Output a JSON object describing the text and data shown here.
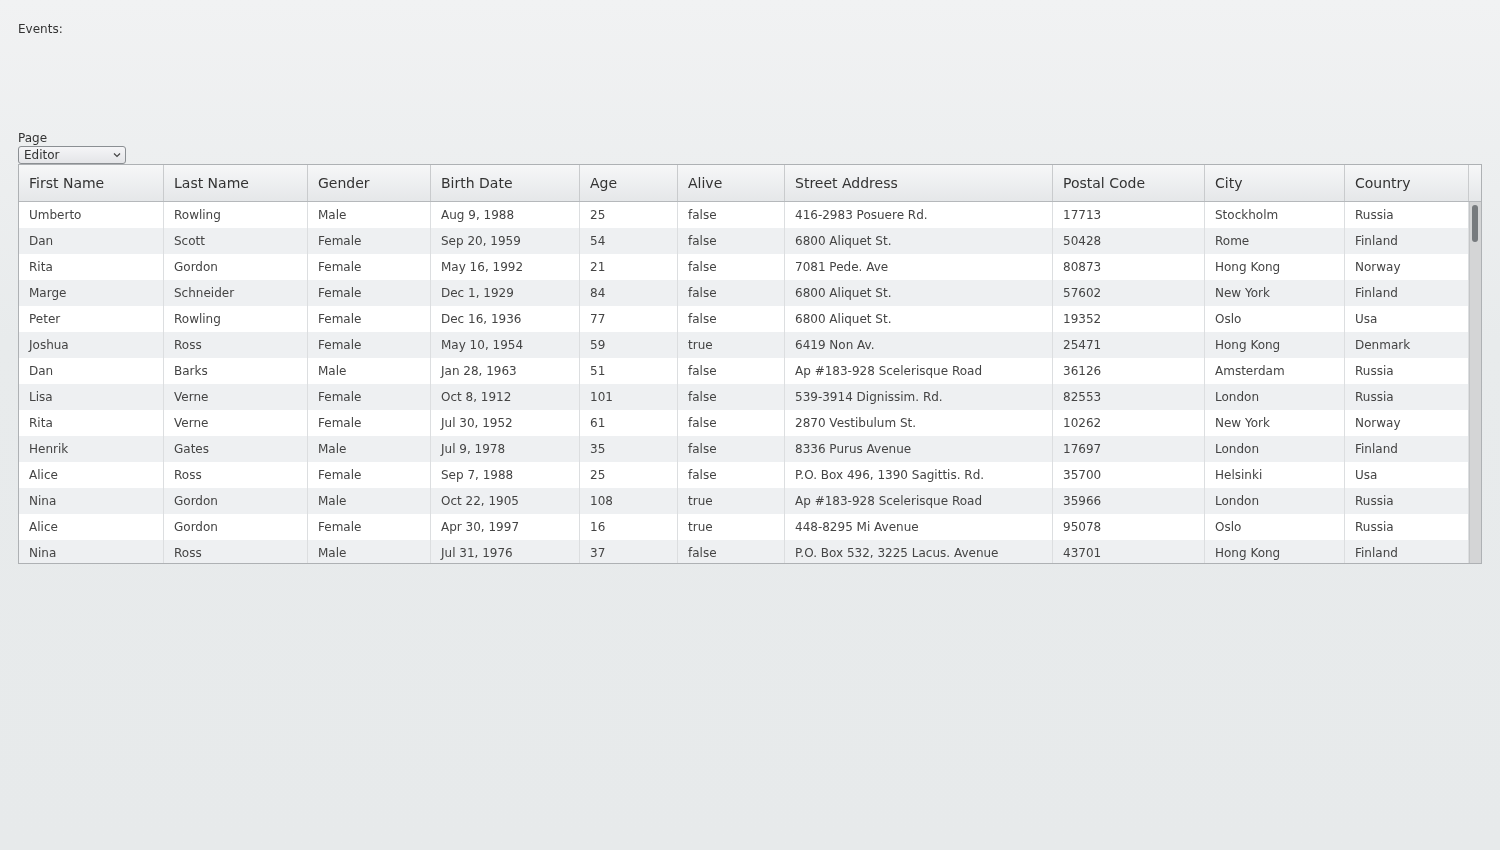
{
  "events_label": "Events:",
  "page_select": {
    "label": "Page",
    "value": "Editor"
  },
  "table": {
    "columns": [
      "First Name",
      "Last Name",
      "Gender",
      "Birth Date",
      "Age",
      "Alive",
      "Street Address",
      "Postal Code",
      "City",
      "Country"
    ],
    "rows": [
      [
        "Umberto",
        "Rowling",
        "Male",
        "Aug 9, 1988",
        "25",
        "false",
        "416-2983 Posuere Rd.",
        "17713",
        "Stockholm",
        "Russia"
      ],
      [
        "Dan",
        "Scott",
        "Female",
        "Sep 20, 1959",
        "54",
        "false",
        "6800 Aliquet St.",
        "50428",
        "Rome",
        "Finland"
      ],
      [
        "Rita",
        "Gordon",
        "Female",
        "May 16, 1992",
        "21",
        "false",
        "7081 Pede. Ave",
        "80873",
        "Hong Kong",
        "Norway"
      ],
      [
        "Marge",
        "Schneider",
        "Female",
        "Dec 1, 1929",
        "84",
        "false",
        "6800 Aliquet St.",
        "57602",
        "New York",
        "Finland"
      ],
      [
        "Peter",
        "Rowling",
        "Female",
        "Dec 16, 1936",
        "77",
        "false",
        "6800 Aliquet St.",
        "19352",
        "Oslo",
        "Usa"
      ],
      [
        "Joshua",
        "Ross",
        "Female",
        "May 10, 1954",
        "59",
        "true",
        "6419 Non Av.",
        "25471",
        "Hong Kong",
        "Denmark"
      ],
      [
        "Dan",
        "Barks",
        "Male",
        "Jan 28, 1963",
        "51",
        "false",
        "Ap #183-928 Scelerisque Road",
        "36126",
        "Amsterdam",
        "Russia"
      ],
      [
        "Lisa",
        "Verne",
        "Female",
        "Oct 8, 1912",
        "101",
        "false",
        "539-3914 Dignissim. Rd.",
        "82553",
        "London",
        "Russia"
      ],
      [
        "Rita",
        "Verne",
        "Female",
        "Jul 30, 1952",
        "61",
        "false",
        "2870 Vestibulum St.",
        "10262",
        "New York",
        "Norway"
      ],
      [
        "Henrik",
        "Gates",
        "Male",
        "Jul 9, 1978",
        "35",
        "false",
        "8336 Purus Avenue",
        "17697",
        "London",
        "Finland"
      ],
      [
        "Alice",
        "Ross",
        "Female",
        "Sep 7, 1988",
        "25",
        "false",
        "P.O. Box 496, 1390 Sagittis. Rd.",
        "35700",
        "Helsinki",
        "Usa"
      ],
      [
        "Nina",
        "Gordon",
        "Male",
        "Oct 22, 1905",
        "108",
        "true",
        "Ap #183-928 Scelerisque Road",
        "35966",
        "London",
        "Russia"
      ],
      [
        "Alice",
        "Gordon",
        "Female",
        "Apr 30, 1997",
        "16",
        "true",
        "448-8295 Mi Avenue",
        "95078",
        "Oslo",
        "Russia"
      ],
      [
        "Nina",
        "Ross",
        "Male",
        "Jul 31, 1976",
        "37",
        "false",
        "P.O. Box 532, 3225 Lacus. Avenue",
        "43701",
        "Hong Kong",
        "Finland"
      ]
    ]
  }
}
